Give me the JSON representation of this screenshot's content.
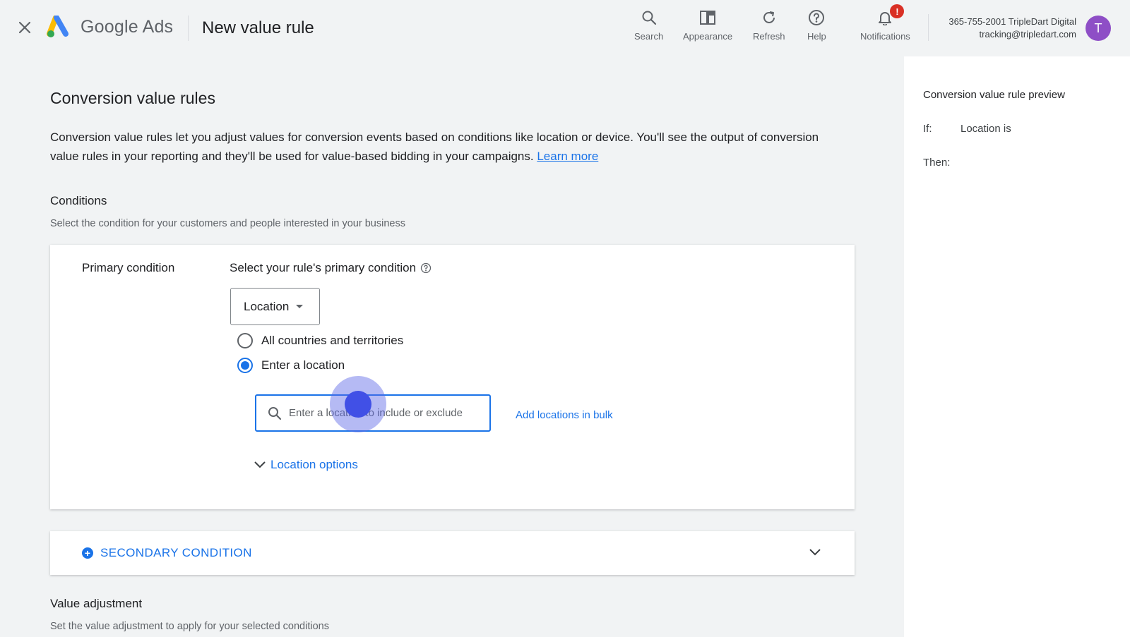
{
  "header": {
    "brand": "Google Ads",
    "title": "New value rule",
    "tools": [
      {
        "label": "Search",
        "icon": "search-icon"
      },
      {
        "label": "Appearance",
        "icon": "appearance-icon"
      },
      {
        "label": "Refresh",
        "icon": "refresh-icon"
      },
      {
        "label": "Help",
        "icon": "help-icon"
      },
      {
        "label": "Notifications",
        "icon": "bell-icon",
        "badge": "!"
      }
    ],
    "account": {
      "line1": "365-755-2001 TripleDart Digital",
      "line2": "tracking@tripledart.com",
      "avatar_initial": "T",
      "avatar_color": "#8e4ec6"
    }
  },
  "main": {
    "heading": "Conversion value rules",
    "intro": "Conversion value rules let you adjust values for conversion events based on conditions like location or device. You'll see the output of conversion value rules in your reporting and they'll be used for value-based bidding in your campaigns.",
    "learn_more": "Learn more",
    "conditions": {
      "heading": "Conditions",
      "subtitle": "Select the condition for your customers and people interested in your business",
      "primary": {
        "label": "Primary condition",
        "title": "Select your rule's primary condition",
        "dropdown_value": "Location",
        "radio_all": "All countries and territories",
        "radio_enter": "Enter a location",
        "selected": "enter",
        "input_placeholder": "Enter a location to include or exclude",
        "bulk_link": "Add locations in bulk",
        "location_options": "Location options"
      },
      "secondary_label": "SECONDARY CONDITION"
    },
    "value_adjustment": {
      "heading": "Value adjustment",
      "subtitle": "Set the value adjustment to apply for your selected conditions"
    }
  },
  "preview": {
    "title": "Conversion value rule preview",
    "if_label": "If:",
    "if_value": "Location is",
    "then_label": "Then:"
  },
  "colors": {
    "accent": "#1a73e8",
    "badge": "#d93025"
  }
}
